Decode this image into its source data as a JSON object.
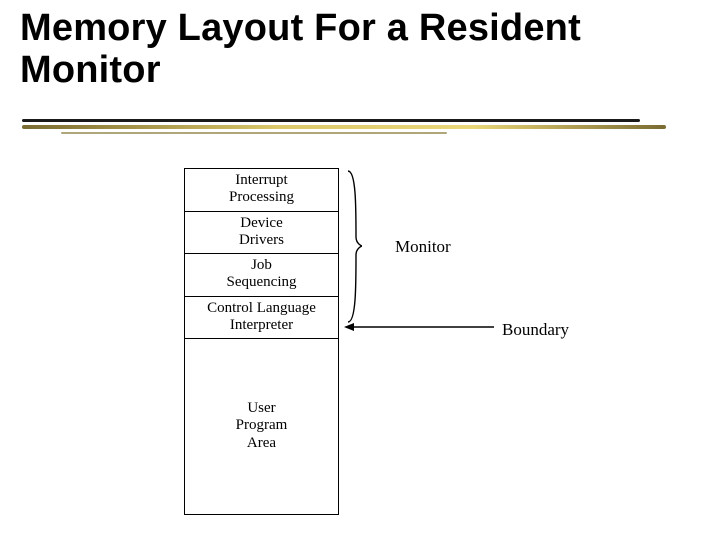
{
  "title": "Memory Layout For a\nResident Monitor",
  "memory": {
    "cells": [
      "Interrupt\nProcessing",
      "Device\nDrivers",
      "Job\nSequencing",
      "Control Language\nInterpreter"
    ],
    "user_area": "User\nProgram\nArea"
  },
  "labels": {
    "monitor": "Monitor",
    "boundary": "Boundary"
  },
  "colors": {
    "text": "#000000",
    "accent": "#cbb44e"
  }
}
